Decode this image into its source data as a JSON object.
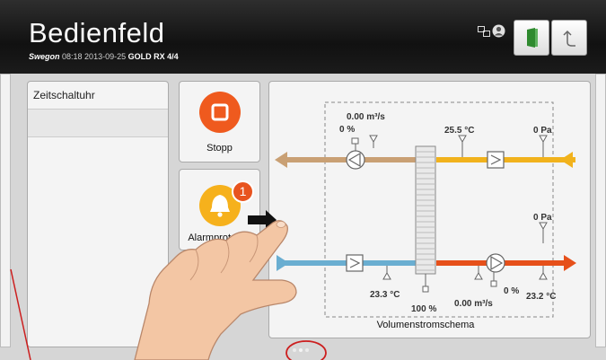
{
  "header": {
    "title": "Bedienfeld",
    "brand": "Swegon",
    "datetime": "08:18 2013-09-25",
    "model": "GOLD RX",
    "page": "4/4",
    "icons": [
      "network-icon",
      "user-icon",
      "exit-door-icon",
      "back-arrow-icon"
    ]
  },
  "sidebar": {
    "items": [
      {
        "label": "Zeitschaltuhr"
      }
    ]
  },
  "controls": {
    "stop_label": "Stopp",
    "alarm_label": "Alarmprotokoll",
    "alarm_count": "1"
  },
  "diagram": {
    "caption": "Volumenstromschema",
    "flow_top": "0.00 m³/s",
    "pct_top": "0 %",
    "temp_top": "25.5 °C",
    "pa_top": "0 Pa",
    "pa_mid": "0 Pa",
    "temp_bottom_left": "23.3 °C",
    "pct_center": "100 %",
    "pct_bottom": "0 %",
    "flow_bottom": "0.00 m³/s",
    "temp_bottom_right": "23.2 °C"
  },
  "pager": {
    "total": 3,
    "active": 1
  },
  "colors": {
    "header_bg": "#161616",
    "stop": "#ef5a1e",
    "alarm": "#f6b11c",
    "badge": "#e8541f",
    "duct_brown": "#c9a074",
    "duct_yellow": "#f1b21c",
    "duct_blue": "#6aaed1",
    "duct_orange": "#e6501a",
    "annotation": "#cc1f1f"
  }
}
